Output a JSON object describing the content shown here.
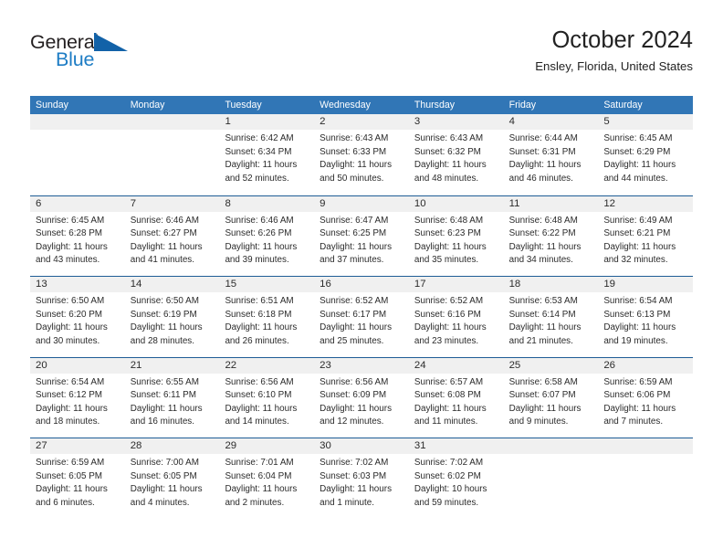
{
  "brand": {
    "name_part1": "General",
    "name_part2": "Blue",
    "logo_icon": "triangle-logo-icon",
    "color_dark": "#231f20",
    "color_blue": "#1d7cc4"
  },
  "header": {
    "title": "October 2024",
    "subtitle": "Ensley, Florida, United States"
  },
  "theme": {
    "header_blue": "#3176b6",
    "separator_blue": "#1f5d96",
    "day_band_gray": "#f0f0f0",
    "text": "#2b2b2b"
  },
  "calendar": {
    "weekday_headers": [
      "Sunday",
      "Monday",
      "Tuesday",
      "Wednesday",
      "Thursday",
      "Friday",
      "Saturday"
    ],
    "weeks": [
      [
        {
          "day": "",
          "sunrise": "",
          "sunset": "",
          "daylight_line1": "",
          "daylight_line2": ""
        },
        {
          "day": "",
          "sunrise": "",
          "sunset": "",
          "daylight_line1": "",
          "daylight_line2": ""
        },
        {
          "day": "1",
          "sunrise": "Sunrise: 6:42 AM",
          "sunset": "Sunset: 6:34 PM",
          "daylight_line1": "Daylight: 11 hours",
          "daylight_line2": "and 52 minutes."
        },
        {
          "day": "2",
          "sunrise": "Sunrise: 6:43 AM",
          "sunset": "Sunset: 6:33 PM",
          "daylight_line1": "Daylight: 11 hours",
          "daylight_line2": "and 50 minutes."
        },
        {
          "day": "3",
          "sunrise": "Sunrise: 6:43 AM",
          "sunset": "Sunset: 6:32 PM",
          "daylight_line1": "Daylight: 11 hours",
          "daylight_line2": "and 48 minutes."
        },
        {
          "day": "4",
          "sunrise": "Sunrise: 6:44 AM",
          "sunset": "Sunset: 6:31 PM",
          "daylight_line1": "Daylight: 11 hours",
          "daylight_line2": "and 46 minutes."
        },
        {
          "day": "5",
          "sunrise": "Sunrise: 6:45 AM",
          "sunset": "Sunset: 6:29 PM",
          "daylight_line1": "Daylight: 11 hours",
          "daylight_line2": "and 44 minutes."
        }
      ],
      [
        {
          "day": "6",
          "sunrise": "Sunrise: 6:45 AM",
          "sunset": "Sunset: 6:28 PM",
          "daylight_line1": "Daylight: 11 hours",
          "daylight_line2": "and 43 minutes."
        },
        {
          "day": "7",
          "sunrise": "Sunrise: 6:46 AM",
          "sunset": "Sunset: 6:27 PM",
          "daylight_line1": "Daylight: 11 hours",
          "daylight_line2": "and 41 minutes."
        },
        {
          "day": "8",
          "sunrise": "Sunrise: 6:46 AM",
          "sunset": "Sunset: 6:26 PM",
          "daylight_line1": "Daylight: 11 hours",
          "daylight_line2": "and 39 minutes."
        },
        {
          "day": "9",
          "sunrise": "Sunrise: 6:47 AM",
          "sunset": "Sunset: 6:25 PM",
          "daylight_line1": "Daylight: 11 hours",
          "daylight_line2": "and 37 minutes."
        },
        {
          "day": "10",
          "sunrise": "Sunrise: 6:48 AM",
          "sunset": "Sunset: 6:23 PM",
          "daylight_line1": "Daylight: 11 hours",
          "daylight_line2": "and 35 minutes."
        },
        {
          "day": "11",
          "sunrise": "Sunrise: 6:48 AM",
          "sunset": "Sunset: 6:22 PM",
          "daylight_line1": "Daylight: 11 hours",
          "daylight_line2": "and 34 minutes."
        },
        {
          "day": "12",
          "sunrise": "Sunrise: 6:49 AM",
          "sunset": "Sunset: 6:21 PM",
          "daylight_line1": "Daylight: 11 hours",
          "daylight_line2": "and 32 minutes."
        }
      ],
      [
        {
          "day": "13",
          "sunrise": "Sunrise: 6:50 AM",
          "sunset": "Sunset: 6:20 PM",
          "daylight_line1": "Daylight: 11 hours",
          "daylight_line2": "and 30 minutes."
        },
        {
          "day": "14",
          "sunrise": "Sunrise: 6:50 AM",
          "sunset": "Sunset: 6:19 PM",
          "daylight_line1": "Daylight: 11 hours",
          "daylight_line2": "and 28 minutes."
        },
        {
          "day": "15",
          "sunrise": "Sunrise: 6:51 AM",
          "sunset": "Sunset: 6:18 PM",
          "daylight_line1": "Daylight: 11 hours",
          "daylight_line2": "and 26 minutes."
        },
        {
          "day": "16",
          "sunrise": "Sunrise: 6:52 AM",
          "sunset": "Sunset: 6:17 PM",
          "daylight_line1": "Daylight: 11 hours",
          "daylight_line2": "and 25 minutes."
        },
        {
          "day": "17",
          "sunrise": "Sunrise: 6:52 AM",
          "sunset": "Sunset: 6:16 PM",
          "daylight_line1": "Daylight: 11 hours",
          "daylight_line2": "and 23 minutes."
        },
        {
          "day": "18",
          "sunrise": "Sunrise: 6:53 AM",
          "sunset": "Sunset: 6:14 PM",
          "daylight_line1": "Daylight: 11 hours",
          "daylight_line2": "and 21 minutes."
        },
        {
          "day": "19",
          "sunrise": "Sunrise: 6:54 AM",
          "sunset": "Sunset: 6:13 PM",
          "daylight_line1": "Daylight: 11 hours",
          "daylight_line2": "and 19 minutes."
        }
      ],
      [
        {
          "day": "20",
          "sunrise": "Sunrise: 6:54 AM",
          "sunset": "Sunset: 6:12 PM",
          "daylight_line1": "Daylight: 11 hours",
          "daylight_line2": "and 18 minutes."
        },
        {
          "day": "21",
          "sunrise": "Sunrise: 6:55 AM",
          "sunset": "Sunset: 6:11 PM",
          "daylight_line1": "Daylight: 11 hours",
          "daylight_line2": "and 16 minutes."
        },
        {
          "day": "22",
          "sunrise": "Sunrise: 6:56 AM",
          "sunset": "Sunset: 6:10 PM",
          "daylight_line1": "Daylight: 11 hours",
          "daylight_line2": "and 14 minutes."
        },
        {
          "day": "23",
          "sunrise": "Sunrise: 6:56 AM",
          "sunset": "Sunset: 6:09 PM",
          "daylight_line1": "Daylight: 11 hours",
          "daylight_line2": "and 12 minutes."
        },
        {
          "day": "24",
          "sunrise": "Sunrise: 6:57 AM",
          "sunset": "Sunset: 6:08 PM",
          "daylight_line1": "Daylight: 11 hours",
          "daylight_line2": "and 11 minutes."
        },
        {
          "day": "25",
          "sunrise": "Sunrise: 6:58 AM",
          "sunset": "Sunset: 6:07 PM",
          "daylight_line1": "Daylight: 11 hours",
          "daylight_line2": "and 9 minutes."
        },
        {
          "day": "26",
          "sunrise": "Sunrise: 6:59 AM",
          "sunset": "Sunset: 6:06 PM",
          "daylight_line1": "Daylight: 11 hours",
          "daylight_line2": "and 7 minutes."
        }
      ],
      [
        {
          "day": "27",
          "sunrise": "Sunrise: 6:59 AM",
          "sunset": "Sunset: 6:05 PM",
          "daylight_line1": "Daylight: 11 hours",
          "daylight_line2": "and 6 minutes."
        },
        {
          "day": "28",
          "sunrise": "Sunrise: 7:00 AM",
          "sunset": "Sunset: 6:05 PM",
          "daylight_line1": "Daylight: 11 hours",
          "daylight_line2": "and 4 minutes."
        },
        {
          "day": "29",
          "sunrise": "Sunrise: 7:01 AM",
          "sunset": "Sunset: 6:04 PM",
          "daylight_line1": "Daylight: 11 hours",
          "daylight_line2": "and 2 minutes."
        },
        {
          "day": "30",
          "sunrise": "Sunrise: 7:02 AM",
          "sunset": "Sunset: 6:03 PM",
          "daylight_line1": "Daylight: 11 hours",
          "daylight_line2": "and 1 minute."
        },
        {
          "day": "31",
          "sunrise": "Sunrise: 7:02 AM",
          "sunset": "Sunset: 6:02 PM",
          "daylight_line1": "Daylight: 10 hours",
          "daylight_line2": "and 59 minutes."
        },
        {
          "day": "",
          "sunrise": "",
          "sunset": "",
          "daylight_line1": "",
          "daylight_line2": ""
        },
        {
          "day": "",
          "sunrise": "",
          "sunset": "",
          "daylight_line1": "",
          "daylight_line2": ""
        }
      ]
    ]
  }
}
